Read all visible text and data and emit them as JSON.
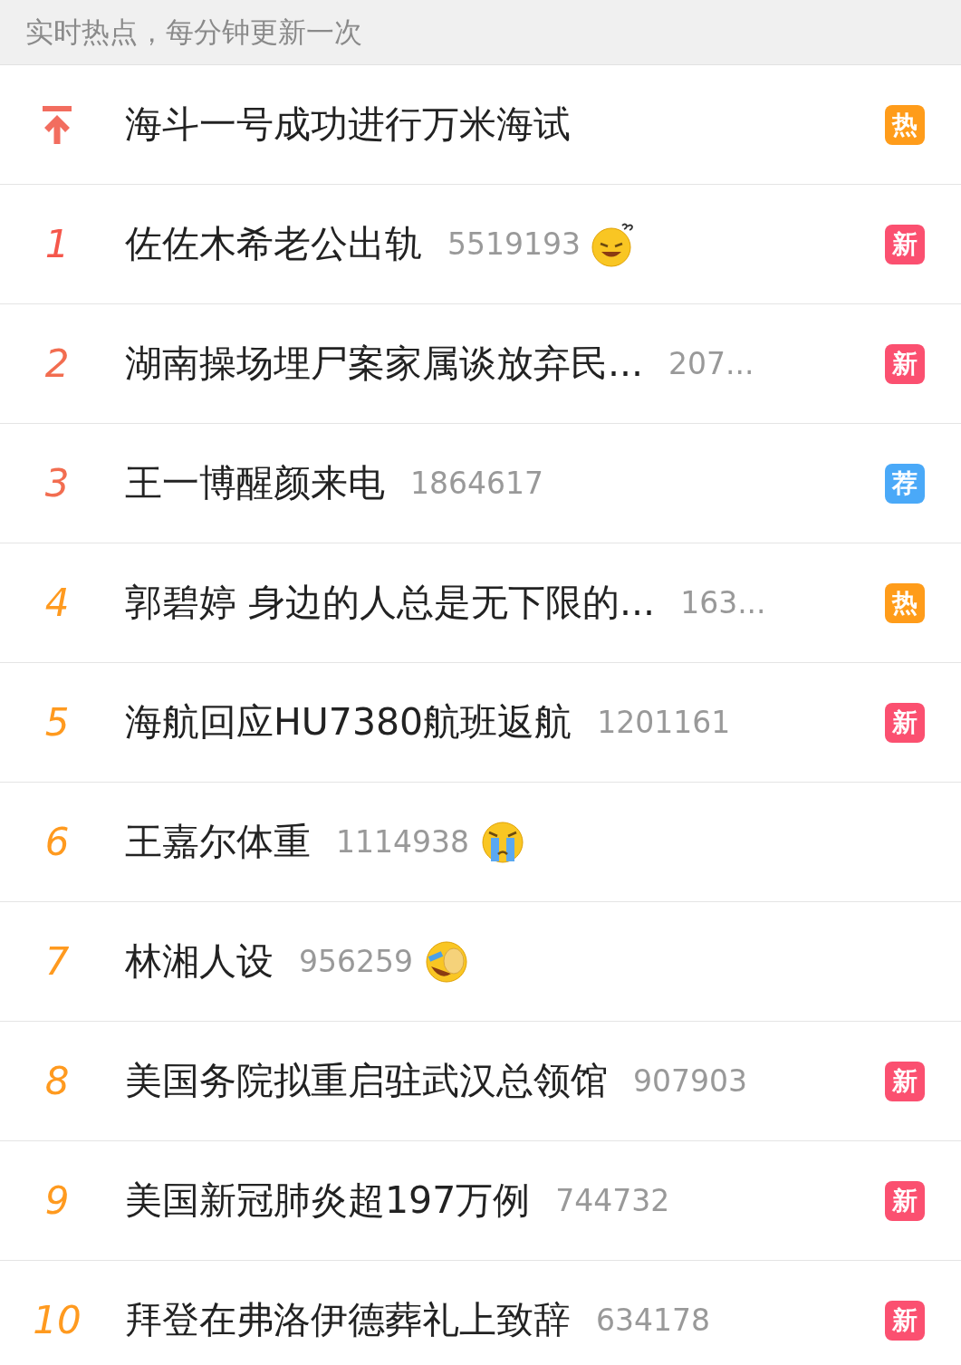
{
  "header": {
    "text": "实时热点，每分钟更新一次"
  },
  "rows": [
    {
      "kind": "pinned",
      "color": "#f26d5f",
      "title": "海斗一号成功进行万米海试",
      "badge": {
        "label": "热",
        "color": "#ff9c1a"
      }
    },
    {
      "kind": "ranked",
      "rank": "1",
      "color": "#f5574b",
      "title": "佐佐木希老公出轨",
      "count": "5519193",
      "emoji": {
        "kind": "puzzled"
      },
      "badge": {
        "label": "新",
        "color": "#fb5070"
      }
    },
    {
      "kind": "ranked",
      "rank": "2",
      "color": "#f26d50",
      "title": "湖南操场埋尸案家属谈放弃民...",
      "count": "207...",
      "badge": {
        "label": "新",
        "color": "#fb5070"
      }
    },
    {
      "kind": "ranked",
      "rank": "3",
      "color": "#f26d50",
      "title": "王一博醒颜来电",
      "count": "1864617",
      "badge": {
        "label": "荐",
        "color": "#4aa9f8"
      }
    },
    {
      "kind": "ranked",
      "rank": "4",
      "color": "#ff9a1f",
      "title": "郭碧婷 身边的人总是无下限的...",
      "count": "163...",
      "badge": {
        "label": "热",
        "color": "#ff9c1a"
      }
    },
    {
      "kind": "ranked",
      "rank": "5",
      "color": "#ff9a1f",
      "title": "海航回应HU7380航班返航",
      "count": "1201161",
      "badge": {
        "label": "新",
        "color": "#fb5070"
      }
    },
    {
      "kind": "ranked",
      "rank": "6",
      "color": "#ff9a1f",
      "title": "王嘉尔体重",
      "count": "1114938",
      "emoji": {
        "kind": "crying"
      }
    },
    {
      "kind": "ranked",
      "rank": "7",
      "color": "#ff9a1f",
      "title": "林湘人设",
      "count": "956259",
      "emoji": {
        "kind": "laughing"
      }
    },
    {
      "kind": "ranked",
      "rank": "8",
      "color": "#ff9a1f",
      "title": "美国务院拟重启驻武汉总领馆",
      "count": "907903",
      "badge": {
        "label": "新",
        "color": "#fb5070"
      }
    },
    {
      "kind": "ranked",
      "rank": "9",
      "color": "#ff9a1f",
      "title": "美国新冠肺炎超197万例",
      "count": "744732",
      "badge": {
        "label": "新",
        "color": "#fb5070"
      }
    },
    {
      "kind": "ranked",
      "rank": "10",
      "color": "#ff9a1f",
      "title": "拜登在弗洛伊德葬礼上致辞",
      "count": "634178",
      "badge": {
        "label": "新",
        "color": "#fb5070"
      }
    }
  ]
}
